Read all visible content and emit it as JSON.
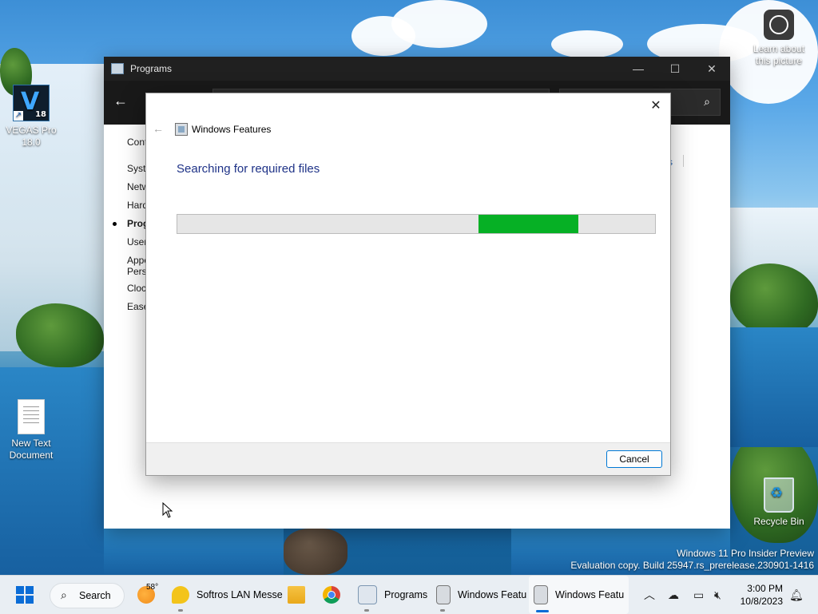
{
  "desktop": {
    "icons": [
      {
        "label": "VEGAS Pro 18.0",
        "icon": "vegas-pro-icon"
      },
      {
        "label": "New Text Document",
        "icon": "text-document-icon"
      },
      {
        "label": "Recycle Bin",
        "icon": "recycle-bin-icon"
      }
    ],
    "learn_label": "Learn about this picture",
    "watermark": {
      "line1": "Windows 11 Pro Insider Preview",
      "line2": "Evaluation copy. Build 25947.rs_prerelease.230901-1416"
    }
  },
  "programs_window": {
    "title": "Programs",
    "controls": {
      "minimize": "—",
      "maximize": "☐",
      "close": "✕"
    },
    "sidebar_partial": [
      "Cont",
      "Syste",
      "Netw",
      "Hard",
      "Prog",
      "User",
      "Appe",
      "Perso",
      "Clock",
      "Ease"
    ],
    "active_item_index": 4,
    "link_partial": "s"
  },
  "dialog": {
    "title": "Windows Features",
    "heading": "Searching for required files",
    "progress": {
      "segment_start": 0.63,
      "segment_end": 0.84,
      "color": "#06B025"
    },
    "cancel_label": "Cancel",
    "close_glyph": "✕",
    "back_glyph": "←"
  },
  "taskbar": {
    "search_label": "Search",
    "weather_temp": "58°",
    "apps": [
      {
        "label": "Softros LAN Messe",
        "icon": "softros-icon"
      },
      {
        "label": "",
        "icon": "file-explorer-icon"
      },
      {
        "label": "",
        "icon": "chrome-icon"
      },
      {
        "label": "Programs",
        "icon": "control-panel-icon"
      },
      {
        "label": "Windows Featu",
        "icon": "windows-features-icon"
      },
      {
        "label": "Windows Featu",
        "icon": "windows-features-icon",
        "active": true
      }
    ],
    "clock": {
      "time": "3:00 PM",
      "date": "10/8/2023"
    },
    "accent": "#0A6CD6"
  }
}
